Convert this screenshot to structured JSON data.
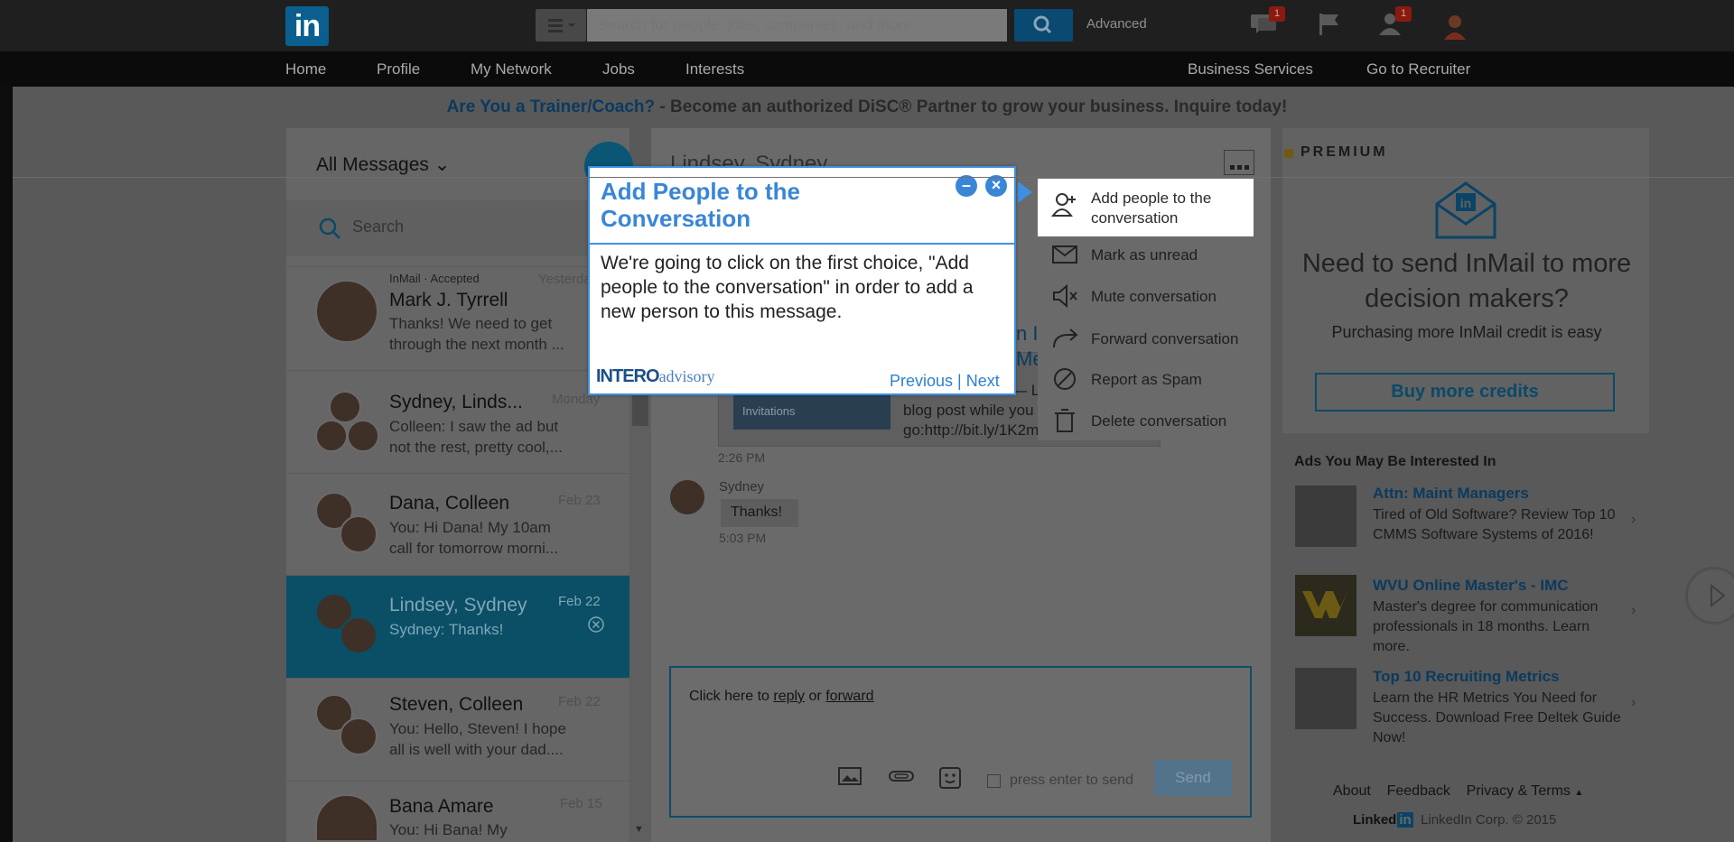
{
  "topbar": {
    "logo": "in",
    "search_placeholder": "Search for people, jobs, companies, and more...",
    "advanced": "Advanced",
    "messages_badge": "1",
    "notifications_badge": "1"
  },
  "nav": {
    "items": [
      "Home",
      "Profile",
      "My Network",
      "Jobs",
      "Interests"
    ],
    "right_items": [
      "Business Services",
      "Go to Recruiter"
    ]
  },
  "promo": {
    "link": "Are You a Trainer/Coach?",
    "text": " - Become an authorized DiSC® Partner to grow your business. Inquire today!"
  },
  "messages": {
    "filter": "All Messages",
    "search_placeholder": "Search",
    "conversations": [
      {
        "tag": "InMail · Accepted",
        "name": "Mark J. Tyrrell",
        "date": "Yesterday",
        "preview": "Thanks! We need to get through the next month ..."
      },
      {
        "name": "Sydney, Linds...",
        "date": "Monday",
        "preview": "Colleen: I saw the ad but not the rest, pretty cool,..."
      },
      {
        "name": "Dana, Colleen",
        "date": "Feb 23",
        "preview": "You: Hi Dana! My 10am call for tomorrow morni..."
      },
      {
        "name": "Lindsey, Sydney",
        "date": "Feb 22",
        "preview": "Sydney: Thanks!"
      },
      {
        "name": "Steven, Colleen",
        "date": "Feb 22",
        "preview": "You: Hello, Steven! I hope all is well with your dad...."
      },
      {
        "name": "Bana Amare",
        "date": "Feb 15",
        "preview": "You: Hi Bana! My"
      }
    ]
  },
  "thread": {
    "title": "Lindsey, Sydney",
    "link_preview_title": "n I Mes",
    "link_preview_lines": [
      "— Li",
      "blog post while you",
      "go:http://bit.ly/1K2m"
    ],
    "image_caption": [
      "Invitations"
    ],
    "time1": "2:26 PM",
    "sender": "Sydney",
    "message": "Thanks!",
    "time2": "5:03 PM",
    "reply_prefix": "Click here to ",
    "reply_link": "reply",
    "reply_or": " or ",
    "forward_link": "forward",
    "press_enter": "press enter to send",
    "send": "Send"
  },
  "dropdown": {
    "items": [
      "Add people to the conversation",
      "Mark as unread",
      "Mute conversation",
      "Forward conversation",
      "Report as Spam",
      "Delete conversation"
    ]
  },
  "popup": {
    "title": "Add People to the Conversation",
    "body": "We're going to click on the first choice, \"Add people to the conversation\" in order to add a new person to this message.",
    "previous": "Previous",
    "separator": "|",
    "next": "Next",
    "brand_bold": "INTERO",
    "brand_light": "advisory"
  },
  "premium": {
    "label": "PREMIUM",
    "headline": "Need to send InMail to more decision makers?",
    "sub": "Purchasing more InMail credit is easy",
    "button": "Buy more credits"
  },
  "ads": {
    "heading": "Ads You May Be Interested In",
    "items": [
      {
        "title": "Attn: Maint Managers",
        "body": "Tired of Old Software? Review Top 10 CMMS Software Systems of 2016!"
      },
      {
        "title": "WVU Online Master's - IMC",
        "body": "Master's degree for communication professionals in 18 months. Learn more."
      },
      {
        "title": "Top 10 Recruiting Metrics",
        "body": "Learn the HR Metrics You Need for Success. Download Free Deltek Guide Now!"
      }
    ]
  },
  "footer": {
    "links": [
      "About",
      "Feedback",
      "Privacy & Terms"
    ],
    "brand": "Linked",
    "brand_in": "in",
    "copyright": "LinkedIn Corp. © 2015"
  },
  "colors": {
    "accent": "#3e8fe3",
    "linkedin_blue": "#0a5f8f",
    "overlay": "#595959"
  }
}
